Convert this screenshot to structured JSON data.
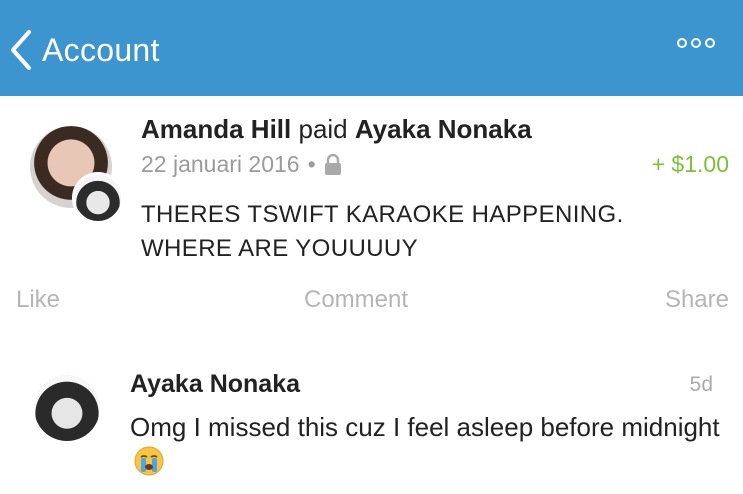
{
  "navbar": {
    "back_label": "Account",
    "background": "#3d95d0"
  },
  "payment": {
    "payer": "Amanda Hill",
    "verb": "paid",
    "payee": "Ayaka Nonaka",
    "date": "22 januari 2016",
    "separator": "•",
    "privacy_icon": "lock-icon",
    "amount": "+ $1.00",
    "amount_color": "#7fbe3b",
    "message": "THERES TSWIFT KARAOKE HAPPENING. WHERE ARE YOUUUUY"
  },
  "actions": {
    "like": "Like",
    "comment": "Comment",
    "share": "Share"
  },
  "comment": {
    "author": "Ayaka Nonaka",
    "time": "5d",
    "text": "Omg I missed this cuz I feel asleep before midnight",
    "emoji_icon": "crying-face-icon"
  }
}
